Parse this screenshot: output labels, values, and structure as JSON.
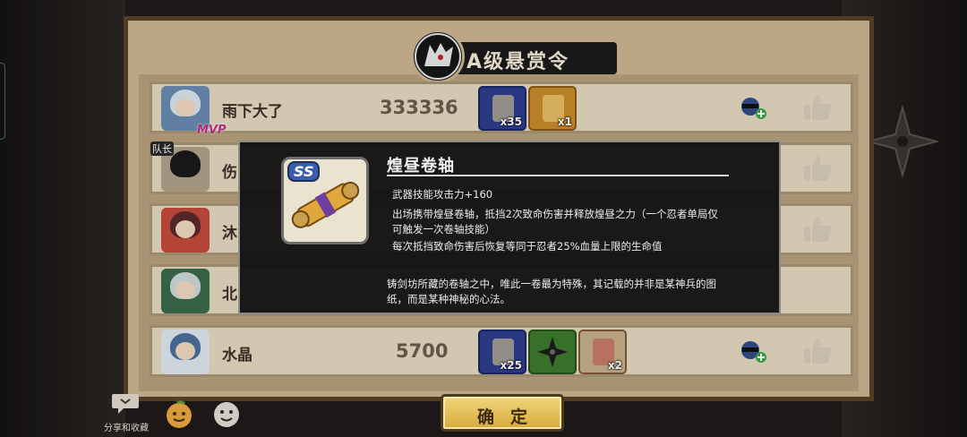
{
  "board": {
    "title": "A级悬赏令"
  },
  "rows": [
    {
      "name": "雨下大了",
      "score": "333336",
      "badge": "MVP",
      "items": [
        {
          "count": "x35",
          "style": "blue"
        },
        {
          "count": "x1",
          "style": "gold"
        }
      ]
    },
    {
      "name": "伤",
      "score": "",
      "badge": "队长",
      "items": []
    },
    {
      "name": "沐",
      "score": "",
      "badge": "",
      "items": []
    },
    {
      "name": "北",
      "score": "",
      "badge": "",
      "items": []
    },
    {
      "name": "水晶",
      "score": "5700",
      "badge": "",
      "items": [
        {
          "count": "x25",
          "style": "blue"
        },
        {
          "count": "",
          "style": "green"
        },
        {
          "count": "x2",
          "style": "rust"
        }
      ]
    }
  ],
  "popup": {
    "badge": "SS",
    "title": "煌昼卷轴",
    "line1": "武器技能攻击力+160",
    "line2": "出场携带煌昼卷轴，抵挡2次致命伤害并释放煌昼之力（一个忍者单局仅可触发一次卷轴技能）",
    "line3": "每次抵挡致命伤害后恢复等同于忍者25%血量上限的生命值",
    "flavor": "铸剑坊所藏的卷轴之中，唯此一卷最为特殊，其记载的并非是某神兵的图纸，而是某种神秘的心法。"
  },
  "footer": {
    "confirm": "确定",
    "share": "分享和收藏"
  },
  "icons": {
    "add_friend": "add-friend-icon",
    "like": "thumbs-up-icon",
    "share": "share-bubble-icon",
    "emoji_orange": "orange-face-icon",
    "emoji_white": "smiley-icon"
  },
  "colors": {
    "board": "#cbb592",
    "confirm": "#e6bf57",
    "popup": "#121212"
  }
}
